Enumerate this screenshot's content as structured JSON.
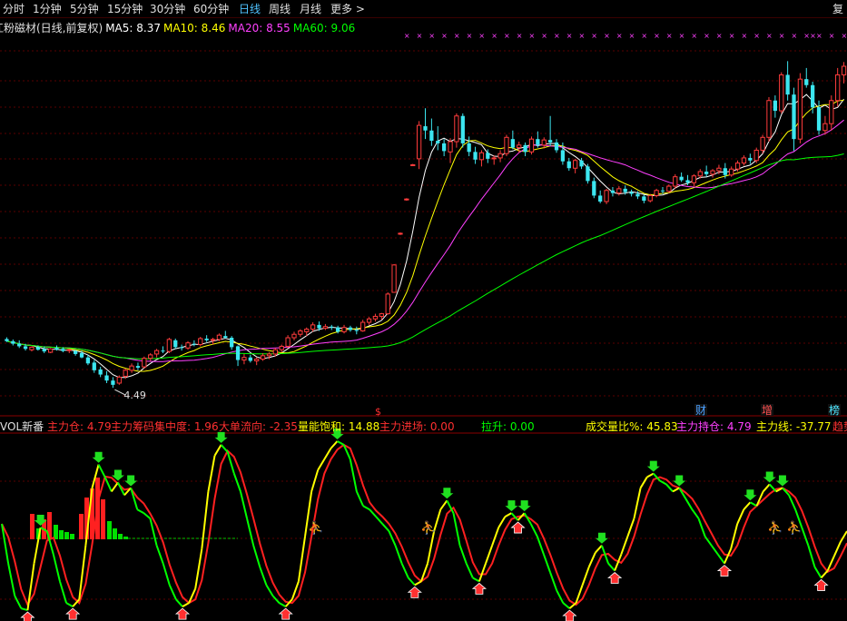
{
  "toolbar": {
    "tabs": [
      "分时",
      "1分钟",
      "5分钟",
      "15分钟",
      "30分钟",
      "60分钟",
      "日线",
      "周线",
      "月线",
      "更多 >"
    ],
    "active_tab": "日线",
    "right_label": "复"
  },
  "main_chart": {
    "title": "江粉磁材(日线,前复权)",
    "ma": [
      {
        "label": "MA5: 8.37",
        "color": "#ffffff"
      },
      {
        "label": "MA10: 8.46",
        "color": "#ffff00"
      },
      {
        "label": "MA20: 8.55",
        "color": "#ff40ff"
      },
      {
        "label": "MA60: 9.06",
        "color": "#00ff00"
      }
    ],
    "low_marker": "4.49",
    "tags": [
      "财",
      "增",
      "榜"
    ],
    "event_mark": "$"
  },
  "indicator": {
    "name": "VOL新番",
    "items": [
      {
        "label": "主力仓: 4.79",
        "color": "#ff3030"
      },
      {
        "label": "主力筹码集中度: 1.96",
        "color": "#ff3030"
      },
      {
        "label": "大单流向: -2.35",
        "color": "#ff3030"
      },
      {
        "label": "量能饱和: 14.88",
        "color": "#ffff00"
      },
      {
        "label": "主力进场: 0.00",
        "color": "#ff3030"
      },
      {
        "label": "拉升: 0.00",
        "color": "#00ff00"
      },
      {
        "label": "成交量比%: 45.83",
        "color": "#ffff00"
      },
      {
        "label": "主力持仓: 4.79",
        "color": "#ff40ff"
      },
      {
        "label": "主力线: -37.77",
        "color": "#ffff00"
      },
      {
        "label": "趋势",
        "color": "#ff3030"
      }
    ]
  },
  "chart_data": {
    "type": "candlestick",
    "title": "江粉磁材(日线,前复权)",
    "ylim": [
      3.9,
      12.7
    ],
    "candles": [
      {
        "o": 5.63,
        "h": 5.67,
        "l": 5.56,
        "c": 5.58
      },
      {
        "o": 5.58,
        "h": 5.62,
        "l": 5.48,
        "c": 5.52
      },
      {
        "o": 5.52,
        "h": 5.6,
        "l": 5.42,
        "c": 5.46
      },
      {
        "o": 5.46,
        "h": 5.52,
        "l": 5.36,
        "c": 5.4
      },
      {
        "o": 5.38,
        "h": 5.46,
        "l": 5.34,
        "c": 5.44
      },
      {
        "o": 5.44,
        "h": 5.48,
        "l": 5.36,
        "c": 5.38
      },
      {
        "o": 5.4,
        "h": 5.46,
        "l": 5.3,
        "c": 5.34
      },
      {
        "o": 5.32,
        "h": 5.42,
        "l": 5.3,
        "c": 5.4
      },
      {
        "o": 5.42,
        "h": 5.48,
        "l": 5.36,
        "c": 5.38
      },
      {
        "o": 5.4,
        "h": 5.44,
        "l": 5.32,
        "c": 5.35
      },
      {
        "o": 5.36,
        "h": 5.4,
        "l": 5.3,
        "c": 5.38
      },
      {
        "o": 5.35,
        "h": 5.38,
        "l": 5.24,
        "c": 5.28
      },
      {
        "o": 5.3,
        "h": 5.36,
        "l": 5.18,
        "c": 5.2
      },
      {
        "o": 5.2,
        "h": 5.26,
        "l": 5.02,
        "c": 5.06
      },
      {
        "o": 5.08,
        "h": 5.14,
        "l": 4.84,
        "c": 4.9
      },
      {
        "o": 4.92,
        "h": 4.98,
        "l": 4.74,
        "c": 4.8
      },
      {
        "o": 4.78,
        "h": 4.88,
        "l": 4.6,
        "c": 4.66
      },
      {
        "o": 4.66,
        "h": 4.74,
        "l": 4.49,
        "c": 4.56
      },
      {
        "o": 4.6,
        "h": 4.78,
        "l": 4.56,
        "c": 4.74
      },
      {
        "o": 4.76,
        "h": 4.94,
        "l": 4.7,
        "c": 4.9
      },
      {
        "o": 4.9,
        "h": 5.06,
        "l": 4.84,
        "c": 5.0
      },
      {
        "o": 5.0,
        "h": 5.08,
        "l": 4.9,
        "c": 4.96
      },
      {
        "o": 4.98,
        "h": 5.22,
        "l": 4.94,
        "c": 5.18
      },
      {
        "o": 5.18,
        "h": 5.3,
        "l": 5.12,
        "c": 5.26
      },
      {
        "o": 5.28,
        "h": 5.4,
        "l": 5.2,
        "c": 5.36
      },
      {
        "o": 5.36,
        "h": 5.46,
        "l": 5.3,
        "c": 5.34
      },
      {
        "o": 5.34,
        "h": 5.66,
        "l": 5.3,
        "c": 5.62
      },
      {
        "o": 5.6,
        "h": 5.64,
        "l": 5.4,
        "c": 5.44
      },
      {
        "o": 5.44,
        "h": 5.5,
        "l": 5.36,
        "c": 5.42
      },
      {
        "o": 5.42,
        "h": 5.58,
        "l": 5.38,
        "c": 5.54
      },
      {
        "o": 5.52,
        "h": 5.6,
        "l": 5.46,
        "c": 5.5
      },
      {
        "o": 5.5,
        "h": 5.68,
        "l": 5.46,
        "c": 5.64
      },
      {
        "o": 5.64,
        "h": 5.72,
        "l": 5.56,
        "c": 5.6
      },
      {
        "o": 5.6,
        "h": 5.66,
        "l": 5.5,
        "c": 5.62
      },
      {
        "o": 5.62,
        "h": 5.76,
        "l": 5.58,
        "c": 5.72
      },
      {
        "o": 5.7,
        "h": 5.82,
        "l": 5.64,
        "c": 5.66
      },
      {
        "o": 5.66,
        "h": 5.7,
        "l": 5.38,
        "c": 5.44
      },
      {
        "o": 5.46,
        "h": 5.48,
        "l": 5.0,
        "c": 5.14
      },
      {
        "o": 5.14,
        "h": 5.28,
        "l": 5.04,
        "c": 5.2
      },
      {
        "o": 5.2,
        "h": 5.26,
        "l": 5.08,
        "c": 5.12
      },
      {
        "o": 5.12,
        "h": 5.2,
        "l": 5.02,
        "c": 5.16
      },
      {
        "o": 5.16,
        "h": 5.3,
        "l": 5.12,
        "c": 5.24
      },
      {
        "o": 5.24,
        "h": 5.32,
        "l": 5.16,
        "c": 5.28
      },
      {
        "o": 5.28,
        "h": 5.42,
        "l": 5.22,
        "c": 5.38
      },
      {
        "o": 5.38,
        "h": 5.5,
        "l": 5.32,
        "c": 5.46
      },
      {
        "o": 5.46,
        "h": 5.72,
        "l": 5.42,
        "c": 5.66
      },
      {
        "o": 5.66,
        "h": 5.8,
        "l": 5.6,
        "c": 5.74
      },
      {
        "o": 5.74,
        "h": 5.86,
        "l": 5.68,
        "c": 5.82
      },
      {
        "o": 5.8,
        "h": 5.9,
        "l": 5.7,
        "c": 5.86
      },
      {
        "o": 5.86,
        "h": 6.02,
        "l": 5.8,
        "c": 5.96
      },
      {
        "o": 5.96,
        "h": 6.04,
        "l": 5.82,
        "c": 5.88
      },
      {
        "o": 5.88,
        "h": 5.98,
        "l": 5.84,
        "c": 5.92
      },
      {
        "o": 5.92,
        "h": 5.96,
        "l": 5.84,
        "c": 5.9
      },
      {
        "o": 5.9,
        "h": 5.94,
        "l": 5.76,
        "c": 5.8
      },
      {
        "o": 5.8,
        "h": 5.96,
        "l": 5.76,
        "c": 5.9
      },
      {
        "o": 5.9,
        "h": 5.94,
        "l": 5.8,
        "c": 5.84
      },
      {
        "o": 5.84,
        "h": 5.92,
        "l": 5.74,
        "c": 5.82
      },
      {
        "o": 5.82,
        "h": 6.08,
        "l": 5.8,
        "c": 6.02
      },
      {
        "o": 6.02,
        "h": 6.14,
        "l": 5.96,
        "c": 6.1
      },
      {
        "o": 6.1,
        "h": 6.22,
        "l": 6.04,
        "c": 6.16
      },
      {
        "o": 6.16,
        "h": 6.24,
        "l": 6.08,
        "c": 6.22
      },
      {
        "o": 6.22,
        "h": 6.72,
        "l": 6.2,
        "c": 6.68
      },
      {
        "o": 6.72,
        "h": 7.38,
        "l": 6.72,
        "c": 7.36
      },
      {
        "o": 8.1,
        "h": 8.12,
        "l": 8.06,
        "c": 8.1
      },
      {
        "o": 8.9,
        "h": 8.92,
        "l": 8.86,
        "c": 8.9
      },
      {
        "o": 9.7,
        "h": 9.72,
        "l": 9.68,
        "c": 9.7
      },
      {
        "o": 9.84,
        "h": 10.72,
        "l": 9.6,
        "c": 10.62
      },
      {
        "o": 10.6,
        "h": 11.02,
        "l": 10.3,
        "c": 10.5
      },
      {
        "o": 10.5,
        "h": 10.78,
        "l": 10.14,
        "c": 10.26
      },
      {
        "o": 10.26,
        "h": 10.6,
        "l": 10.04,
        "c": 10.2
      },
      {
        "o": 10.2,
        "h": 10.3,
        "l": 9.9,
        "c": 10.02
      },
      {
        "o": 10.0,
        "h": 10.32,
        "l": 9.74,
        "c": 10.24
      },
      {
        "o": 10.24,
        "h": 10.9,
        "l": 10.1,
        "c": 10.84
      },
      {
        "o": 10.84,
        "h": 10.9,
        "l": 10.1,
        "c": 10.2
      },
      {
        "o": 10.2,
        "h": 10.36,
        "l": 9.9,
        "c": 10.0
      },
      {
        "o": 10.0,
        "h": 10.12,
        "l": 9.72,
        "c": 9.82
      },
      {
        "o": 9.82,
        "h": 10.04,
        "l": 9.66,
        "c": 9.98
      },
      {
        "o": 9.98,
        "h": 10.06,
        "l": 9.74,
        "c": 9.84
      },
      {
        "o": 9.84,
        "h": 9.92,
        "l": 9.7,
        "c": 9.86
      },
      {
        "o": 9.86,
        "h": 10.04,
        "l": 9.76,
        "c": 9.96
      },
      {
        "o": 9.96,
        "h": 10.4,
        "l": 9.9,
        "c": 10.34
      },
      {
        "o": 10.3,
        "h": 10.5,
        "l": 10.06,
        "c": 10.1
      },
      {
        "o": 10.1,
        "h": 10.24,
        "l": 9.98,
        "c": 10.16
      },
      {
        "o": 10.16,
        "h": 10.22,
        "l": 9.9,
        "c": 10.0
      },
      {
        "o": 10.0,
        "h": 10.36,
        "l": 9.94,
        "c": 10.3
      },
      {
        "o": 10.3,
        "h": 10.48,
        "l": 10.1,
        "c": 10.16
      },
      {
        "o": 10.16,
        "h": 10.34,
        "l": 10.08,
        "c": 10.28
      },
      {
        "o": 10.28,
        "h": 10.84,
        "l": 10.14,
        "c": 10.22
      },
      {
        "o": 10.22,
        "h": 10.3,
        "l": 9.98,
        "c": 10.04
      },
      {
        "o": 10.04,
        "h": 10.22,
        "l": 9.7,
        "c": 9.78
      },
      {
        "o": 9.78,
        "h": 9.86,
        "l": 9.56,
        "c": 9.62
      },
      {
        "o": 9.62,
        "h": 9.84,
        "l": 9.5,
        "c": 9.8
      },
      {
        "o": 9.8,
        "h": 9.86,
        "l": 9.6,
        "c": 9.66
      },
      {
        "o": 9.66,
        "h": 9.72,
        "l": 9.26,
        "c": 9.32
      },
      {
        "o": 9.32,
        "h": 9.4,
        "l": 8.92,
        "c": 8.98
      },
      {
        "o": 8.98,
        "h": 9.1,
        "l": 8.8,
        "c": 8.84
      },
      {
        "o": 8.84,
        "h": 9.14,
        "l": 8.78,
        "c": 9.1
      },
      {
        "o": 9.1,
        "h": 9.18,
        "l": 8.96,
        "c": 9.04
      },
      {
        "o": 9.04,
        "h": 9.2,
        "l": 8.98,
        "c": 9.14
      },
      {
        "o": 9.14,
        "h": 9.22,
        "l": 9.0,
        "c": 9.06
      },
      {
        "o": 9.06,
        "h": 9.12,
        "l": 8.96,
        "c": 9.02
      },
      {
        "o": 9.02,
        "h": 9.08,
        "l": 8.9,
        "c": 8.96
      },
      {
        "o": 8.96,
        "h": 9.0,
        "l": 8.8,
        "c": 8.86
      },
      {
        "o": 8.86,
        "h": 9.02,
        "l": 8.82,
        "c": 8.98
      },
      {
        "o": 8.98,
        "h": 9.14,
        "l": 8.94,
        "c": 9.1
      },
      {
        "o": 9.1,
        "h": 9.18,
        "l": 9.02,
        "c": 9.08
      },
      {
        "o": 9.08,
        "h": 9.24,
        "l": 9.04,
        "c": 9.2
      },
      {
        "o": 9.2,
        "h": 9.48,
        "l": 9.14,
        "c": 9.42
      },
      {
        "o": 9.42,
        "h": 9.52,
        "l": 9.3,
        "c": 9.34
      },
      {
        "o": 9.34,
        "h": 9.46,
        "l": 9.22,
        "c": 9.28
      },
      {
        "o": 9.28,
        "h": 9.48,
        "l": 9.2,
        "c": 9.44
      },
      {
        "o": 9.44,
        "h": 9.6,
        "l": 9.38,
        "c": 9.54
      },
      {
        "o": 9.54,
        "h": 9.68,
        "l": 9.42,
        "c": 9.48
      },
      {
        "o": 9.48,
        "h": 9.6,
        "l": 9.4,
        "c": 9.56
      },
      {
        "o": 9.56,
        "h": 9.7,
        "l": 9.48,
        "c": 9.62
      },
      {
        "o": 9.62,
        "h": 9.74,
        "l": 9.38,
        "c": 9.46
      },
      {
        "o": 9.46,
        "h": 9.66,
        "l": 9.42,
        "c": 9.6
      },
      {
        "o": 9.6,
        "h": 9.8,
        "l": 9.54,
        "c": 9.74
      },
      {
        "o": 9.74,
        "h": 9.92,
        "l": 9.68,
        "c": 9.86
      },
      {
        "o": 9.86,
        "h": 9.96,
        "l": 9.72,
        "c": 9.8
      },
      {
        "o": 9.8,
        "h": 10.1,
        "l": 9.74,
        "c": 10.04
      },
      {
        "o": 10.04,
        "h": 10.4,
        "l": 9.96,
        "c": 10.34
      },
      {
        "o": 10.34,
        "h": 11.28,
        "l": 10.24,
        "c": 11.2
      },
      {
        "o": 11.2,
        "h": 11.32,
        "l": 10.8,
        "c": 10.96
      },
      {
        "o": 10.96,
        "h": 11.86,
        "l": 10.9,
        "c": 11.8
      },
      {
        "o": 11.8,
        "h": 12.12,
        "l": 11.2,
        "c": 11.34
      },
      {
        "o": 11.34,
        "h": 11.5,
        "l": 10.02,
        "c": 10.3
      },
      {
        "o": 10.3,
        "h": 11.84,
        "l": 10.2,
        "c": 11.7
      },
      {
        "o": 11.7,
        "h": 11.96,
        "l": 11.5,
        "c": 11.56
      },
      {
        "o": 11.56,
        "h": 11.64,
        "l": 10.9,
        "c": 11.04
      },
      {
        "o": 11.04,
        "h": 11.2,
        "l": 10.4,
        "c": 10.5
      },
      {
        "o": 10.5,
        "h": 10.84,
        "l": 10.4,
        "c": 10.66
      },
      {
        "o": 10.66,
        "h": 11.32,
        "l": 10.5,
        "c": 11.2
      },
      {
        "o": 11.2,
        "h": 11.96,
        "l": 11.06,
        "c": 11.8
      },
      {
        "o": 11.8,
        "h": 12.1,
        "l": 11.6,
        "c": 12.0
      }
    ],
    "ma_series": [
      {
        "name": "MA5",
        "color": "#ffffff",
        "period": 5
      },
      {
        "name": "MA10",
        "color": "#ffff00",
        "period": 10
      },
      {
        "name": "MA20",
        "color": "#ff40ff",
        "period": 20
      },
      {
        "name": "MA60",
        "color": "#00ff00",
        "period": 60
      }
    ],
    "indicator_lines": {
      "yellow": [
        52,
        30,
        12,
        5,
        4,
        30,
        50,
        48,
        35,
        20,
        8,
        6,
        10,
        40,
        72,
        85,
        78,
        70,
        75,
        68,
        72,
        60,
        58,
        55,
        40,
        30,
        18,
        10,
        6,
        8,
        16,
        38,
        70,
        90,
        96,
        92,
        80,
        70,
        55,
        40,
        28,
        18,
        12,
        8,
        6,
        10,
        20,
        45,
        70,
        82,
        88,
        94,
        98,
        96,
        88,
        70,
        62,
        60,
        56,
        52,
        48,
        40,
        30,
        22,
        18,
        20,
        30,
        48,
        60,
        65,
        58,
        40,
        30,
        22,
        20,
        30,
        40,
        50,
        56,
        58,
        54,
        58,
        52,
        45,
        35,
        25,
        15,
        8,
        5,
        8,
        18,
        28,
        36,
        40,
        30,
        26,
        35,
        45,
        55,
        72,
        78,
        80,
        76,
        74,
        70,
        72,
        66,
        60,
        55,
        45,
        40,
        35,
        30,
        38,
        52,
        60,
        64,
        62,
        70,
        74,
        70,
        72,
        68,
        60,
        50,
        40,
        28,
        22,
        26,
        34,
        42,
        48
      ]
    }
  }
}
